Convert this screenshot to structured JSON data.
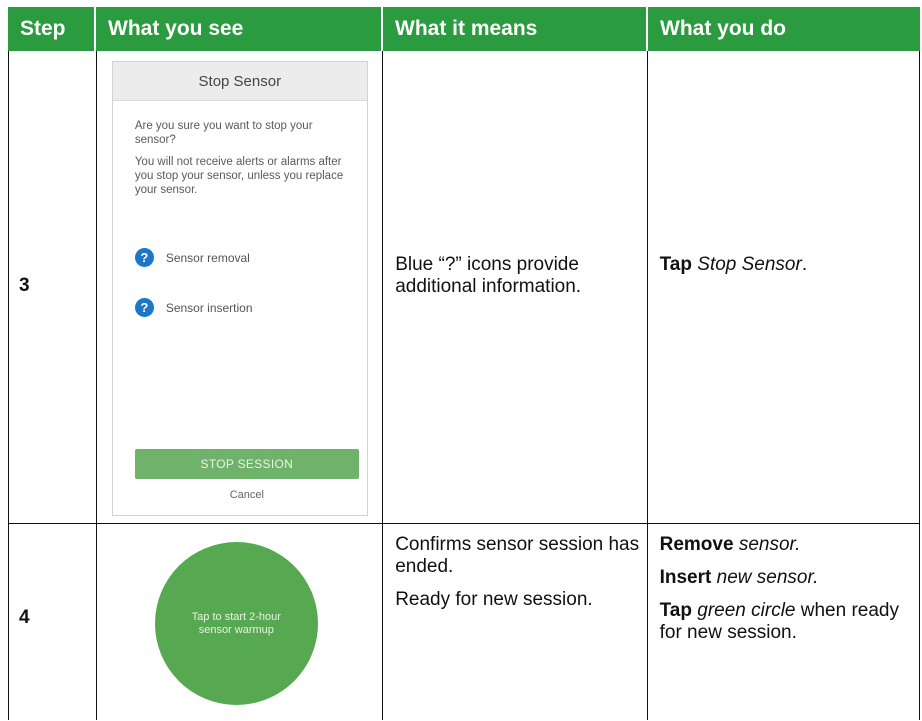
{
  "header": {
    "step": "Step",
    "see": "What you see",
    "means": "What it means",
    "do": "What you do"
  },
  "rows": [
    {
      "step": "3",
      "dialog": {
        "title": "Stop Sensor",
        "text1": "Are you sure you want to stop your sensor?",
        "text2": "You will not receive alerts or alarms after you stop your sensor, unless you replace your sensor.",
        "help_items": [
          "Sensor removal",
          "Sensor insertion"
        ],
        "button": "STOP SESSION",
        "cancel": "Cancel"
      },
      "means": "Blue “?” icons provide additional information.",
      "do": [
        {
          "bold": "Tap",
          "italic": "Stop Sensor",
          "rest": "."
        }
      ]
    },
    {
      "step": "4",
      "circle_text": "Tap to start 2-hour sensor warmup",
      "means": [
        "Confirms sensor session has ended.",
        "Ready for new session."
      ],
      "do": [
        {
          "bold": "Remove",
          "italic": "sensor.",
          "rest": ""
        },
        {
          "bold": "Insert",
          "italic": "new sensor.",
          "rest": ""
        },
        {
          "bold": "Tap",
          "italic": "green circle",
          "rest": " when ready for new session."
        }
      ]
    }
  ]
}
